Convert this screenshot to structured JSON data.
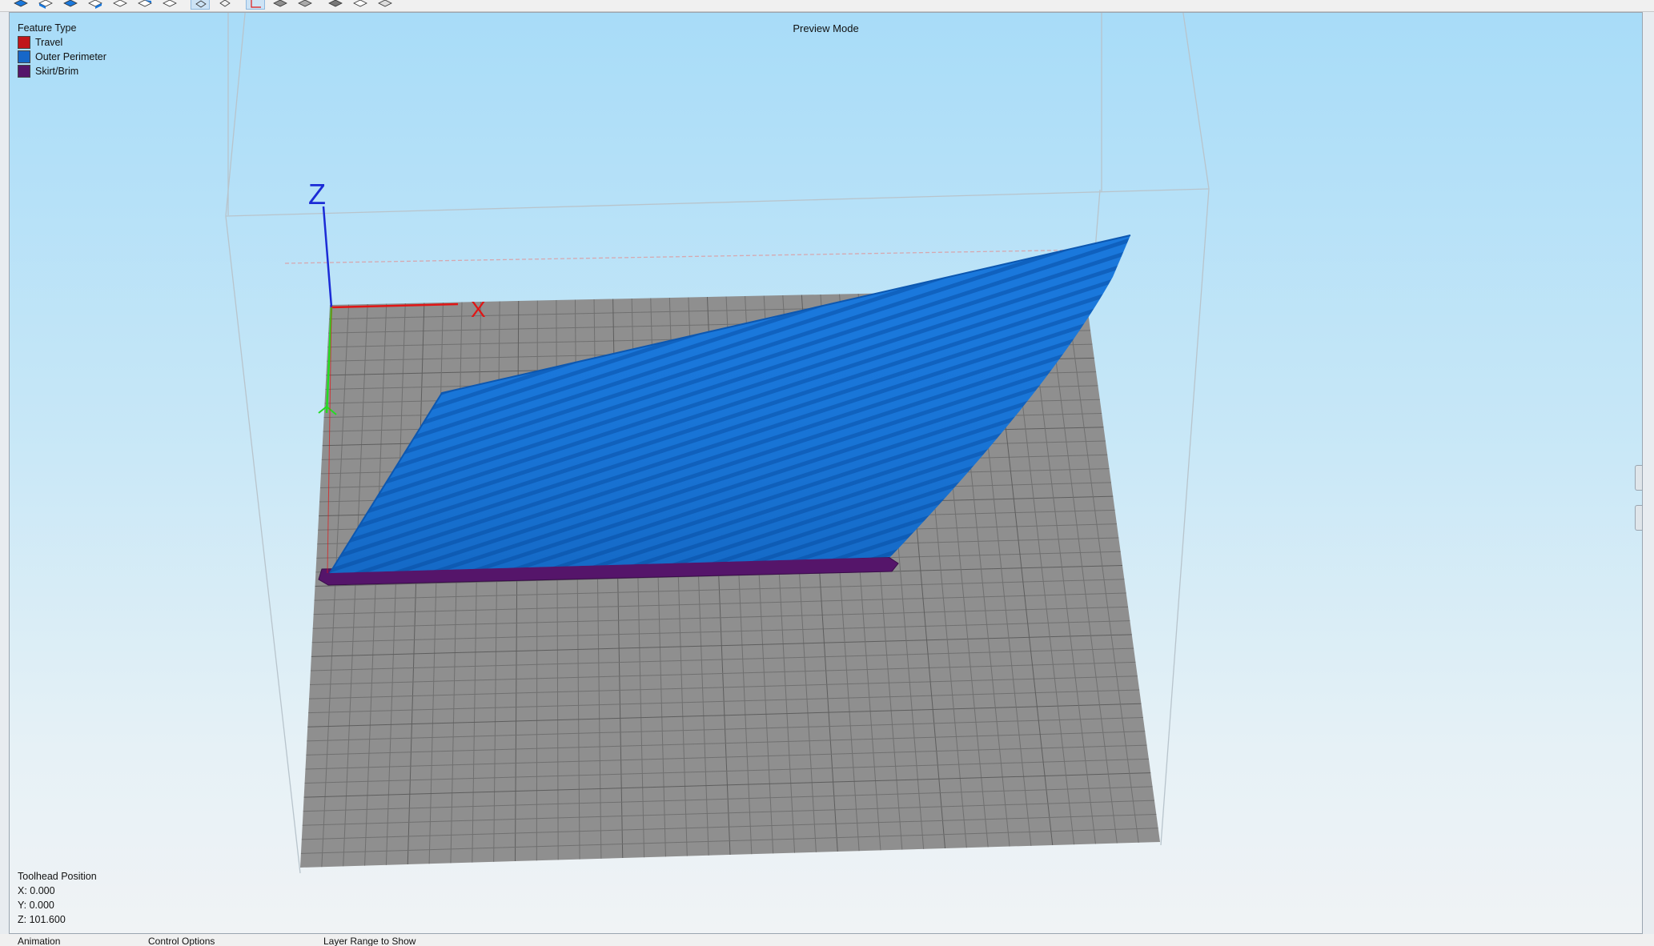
{
  "toolbar": {
    "buttons": [
      {
        "name": "view-iso-icon"
      },
      {
        "name": "view-front-icon"
      },
      {
        "name": "view-top-icon"
      },
      {
        "name": "view-left-icon"
      },
      {
        "name": "view-right-icon"
      },
      {
        "name": "view-back-icon"
      },
      {
        "name": "view-bottom-icon"
      },
      {
        "name": "perspective-icon",
        "active": true
      },
      {
        "name": "orthographic-icon"
      },
      {
        "name": "show-axes-icon",
        "active": true
      },
      {
        "name": "show-bed-icon"
      },
      {
        "name": "show-shadow-icon"
      },
      {
        "name": "show-model-icon"
      },
      {
        "name": "wireframe-icon"
      },
      {
        "name": "transparent-icon"
      }
    ]
  },
  "viewport": {
    "title": "Preview Mode",
    "axes": {
      "x_label": "X",
      "z_label": "Z"
    }
  },
  "legend": {
    "title": "Feature Type",
    "items": [
      {
        "label": "Travel",
        "color": "#c0161b"
      },
      {
        "label": "Outer Perimeter",
        "color": "#1667c8"
      },
      {
        "label": "Skirt/Brim",
        "color": "#55156a"
      }
    ]
  },
  "toolhead": {
    "title": "Toolhead Position",
    "x": "X: 0.000",
    "y": "Y: 0.000",
    "z": "Z: 101.600"
  },
  "colors": {
    "bed": "#8f8f8f",
    "bed_grid": "#6e6e6e",
    "model": "#1a78dc",
    "model_dark": "#0d55a8",
    "skirt": "#55156a",
    "x_axis": "#e01616",
    "y_axis": "#22dd22",
    "z_axis": "#1b2bd6"
  },
  "bottom_tabs": [
    "Animation",
    "Control Options",
    "Layer Range to Show"
  ]
}
